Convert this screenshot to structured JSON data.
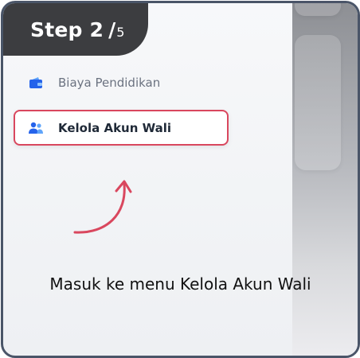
{
  "step": {
    "current": "Step 2",
    "separator": "/",
    "total": "5"
  },
  "menu": {
    "items": [
      {
        "label": "Biaya Pendidikan",
        "icon": "wallet-icon",
        "active": false
      },
      {
        "label": "Kelola Akun Wali",
        "icon": "users-icon",
        "active": true
      }
    ]
  },
  "caption": "Masuk ke menu Kelola Akun Wali",
  "colors": {
    "badge": "#3c3d40",
    "highlight": "#d9475e",
    "icon": "#2563eb"
  }
}
